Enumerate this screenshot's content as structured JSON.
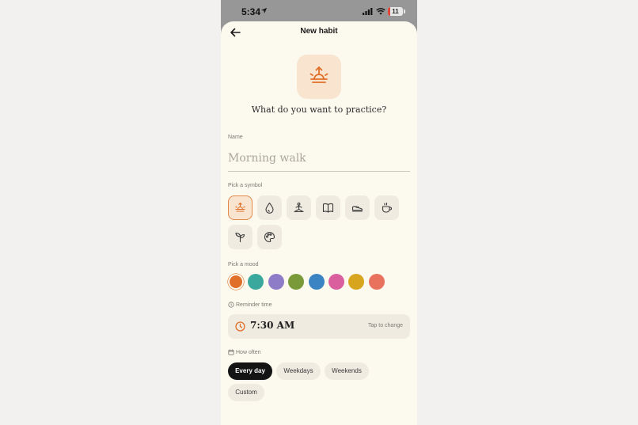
{
  "status_bar": {
    "time": "5:34",
    "battery": "11"
  },
  "header": {
    "title": "New habit"
  },
  "hero": {
    "question": "What do you want to practice?"
  },
  "name": {
    "label": "Name",
    "placeholder": "Morning walk"
  },
  "symbols": {
    "label": "Pick a symbol",
    "items": [
      "sunrise-icon",
      "water-drop-icon",
      "meditation-icon",
      "book-icon",
      "shoe-icon",
      "coffee-cup-icon",
      "sprout-icon",
      "palette-icon"
    ],
    "selected": "sunrise-icon"
  },
  "mood": {
    "label": "Pick a mood",
    "colors": [
      "#e06f2a",
      "#3aa89c",
      "#8f7cc9",
      "#7a9a3a",
      "#3b84c4",
      "#d95f9e",
      "#d8a51f",
      "#e8725e"
    ],
    "selected": "#e06f2a"
  },
  "reminder": {
    "label": "Reminder time",
    "time": "7:30 AM",
    "hint": "Tap to change"
  },
  "frequency": {
    "label": "How often",
    "options": [
      "Every day",
      "Weekdays",
      "Weekends",
      "Custom"
    ],
    "selected": "Every day"
  },
  "colors": {
    "accent": "#e06f2a",
    "sheet": "#fcf9ee",
    "chip": "#efebe0"
  }
}
